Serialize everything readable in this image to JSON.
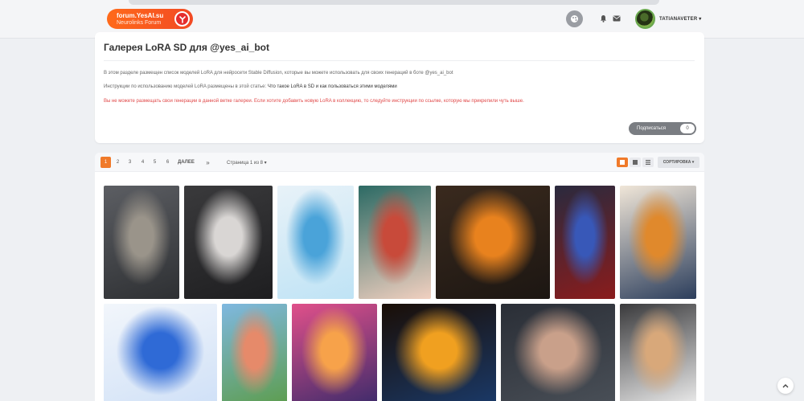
{
  "header": {
    "logo_title": "forum.YesAI.su",
    "logo_subtitle": "Neurolinks Forum",
    "username": "TATIANAVETER ▾",
    "icons": [
      "paint-palette-icon",
      "bell-icon",
      "mail-icon"
    ]
  },
  "info": {
    "title": "Галерея LoRA SD для @yes_ai_bot",
    "para1": "В этом разделе размещен список моделей LoRA для нейросети Stable Diffusion, которые вы можете использовать для своих генераций в боте @yes_ai_bot",
    "para2_prefix": "Инструкции по использованию моделей LoRA размещены в этой статье: ",
    "para2_link": "Что такое LoRA в SD и как пользоваться этими моделями",
    "para3": "Вы не можете размещать свои генерации в данной ветке галереи. Если хотите добавить новую LoRA в коллекцию, то следуйте инструкции по ссылке, которую мы прикрепили чуть выше.",
    "subscribe_label": "Подписаться",
    "subscribe_count": "0"
  },
  "pager": {
    "pages": [
      "1",
      "2",
      "3",
      "4",
      "5",
      "6"
    ],
    "active": "1",
    "next_label": "ДАЛЕЕ",
    "last_label": "»",
    "page_of": "Страница 1 из 8 ▾",
    "sort_label": "СОРТИРОВКА ▾"
  },
  "thumbnails": [
    {
      "name": "warrior-portrait",
      "colors": [
        "#5c5e63",
        "#9a948a",
        "#2e3033"
      ]
    },
    {
      "name": "white-rabbit",
      "colors": [
        "#3a3a3c",
        "#d9d6d4",
        "#1e1e20"
      ]
    },
    {
      "name": "blue-haired-girl",
      "colors": [
        "#e8f2f8",
        "#4aa3d9",
        "#bfe3f5"
      ]
    },
    {
      "name": "red-haired-girl",
      "colors": [
        "#2c6a64",
        "#c84a3a",
        "#f1d0c0"
      ]
    },
    {
      "name": "fox-girl",
      "colors": [
        "#3a2a1e",
        "#e8821e",
        "#1c1612"
      ]
    },
    {
      "name": "blue-fox-character",
      "colors": [
        "#2a2a3e",
        "#3858b8",
        "#8a1c1c"
      ]
    },
    {
      "name": "cats-illustration",
      "colors": [
        "#f0e6d8",
        "#e0892c",
        "#2c3e5c"
      ]
    },
    {
      "name": "blue-flat-girl",
      "colors": [
        "#f2f6fb",
        "#2f6ad6",
        "#cfe0f7"
      ]
    },
    {
      "name": "mountain-landscape",
      "colors": [
        "#7fb8e0",
        "#e68a6a",
        "#5c9c4a"
      ]
    },
    {
      "name": "neon-dress-woman",
      "colors": [
        "#e0508a",
        "#f7a24a",
        "#3a2a6a"
      ]
    },
    {
      "name": "sunflower-eye",
      "colors": [
        "#1a0e06",
        "#f0a020",
        "#1a3a6a"
      ]
    },
    {
      "name": "feet-on-bed",
      "colors": [
        "#2a2e36",
        "#c9a08a",
        "#4a5058"
      ]
    },
    {
      "name": "sandal-feet",
      "colors": [
        "#3a3a3c",
        "#d8a87a",
        "#f0f0f0"
      ]
    }
  ]
}
